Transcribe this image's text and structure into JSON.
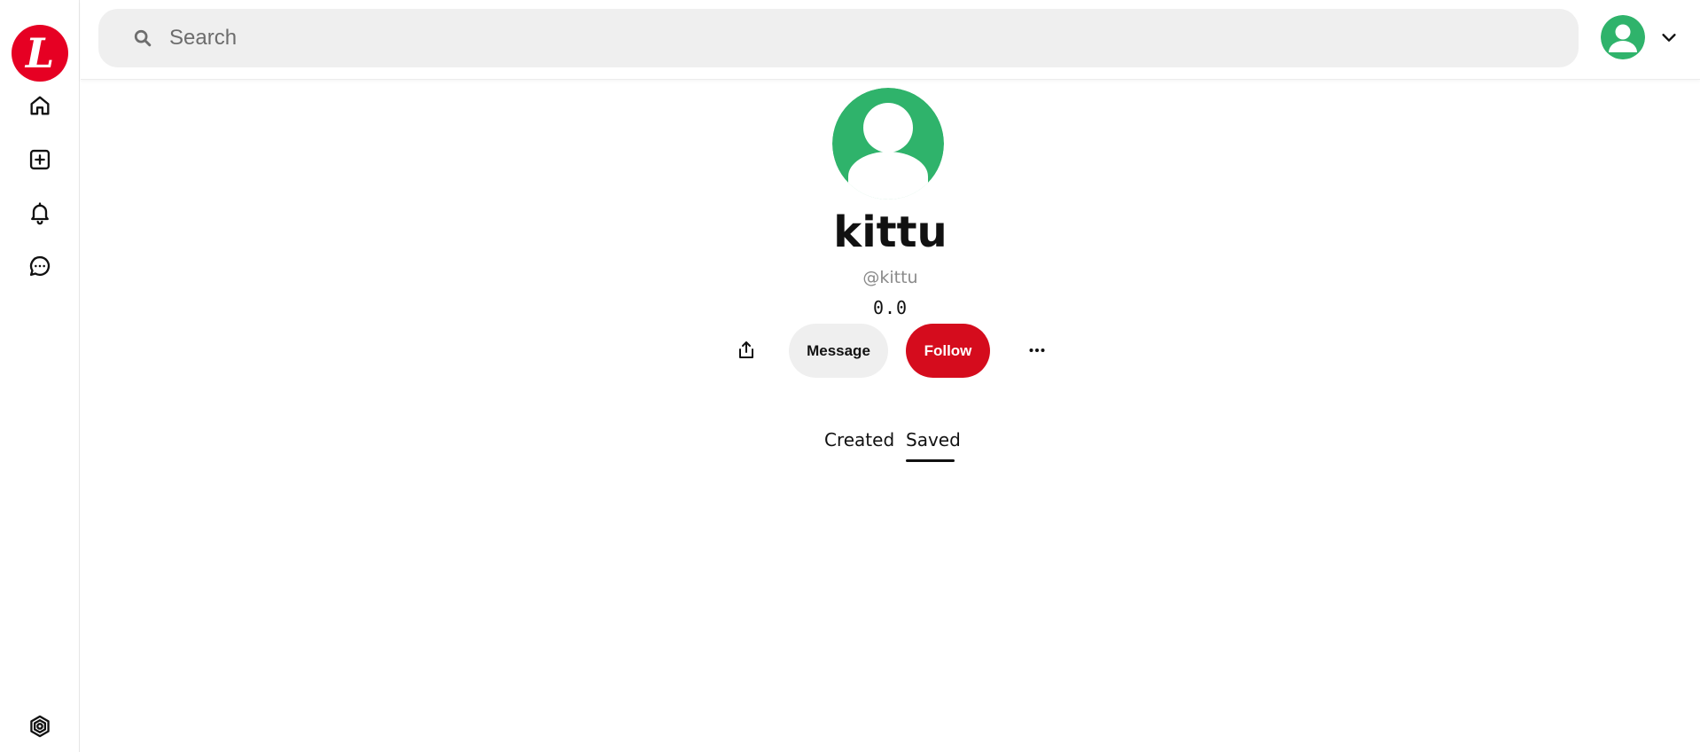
{
  "app": {
    "logo_letter": "L",
    "brand_color": "#e60023"
  },
  "sidebar": {
    "items": [
      {
        "name": "home",
        "icon": "home-icon"
      },
      {
        "name": "create",
        "icon": "plus-square-icon"
      },
      {
        "name": "notifications",
        "icon": "bell-icon"
      },
      {
        "name": "messages",
        "icon": "chat-bubble-icon"
      }
    ],
    "footer_icon": "settings-hexagon-icon"
  },
  "header": {
    "search_placeholder": "Search",
    "avatar_color": "#2fb36b"
  },
  "profile": {
    "name": "kittu",
    "handle": "@kittu",
    "stats": "0.0",
    "avatar_color": "#2fb36b"
  },
  "actions": {
    "message_label": "Message",
    "follow_label": "Follow",
    "follow_color": "#d50c1d"
  },
  "tabs": [
    {
      "label": "Created",
      "active": false
    },
    {
      "label": "Saved",
      "active": true
    }
  ]
}
